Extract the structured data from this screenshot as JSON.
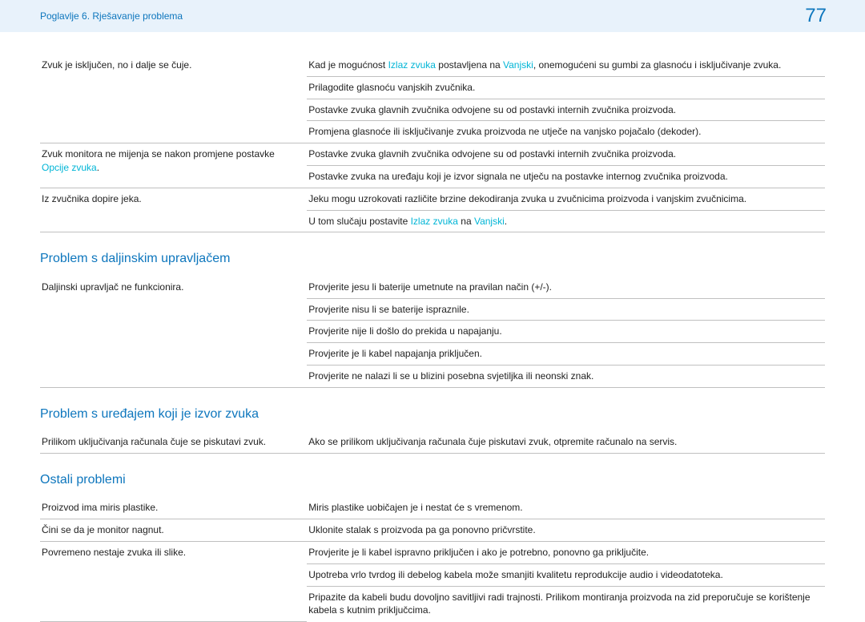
{
  "header": {
    "breadcrumb": "Poglavlje 6. Rješavanje problema",
    "page_number": "77"
  },
  "table1": {
    "rows": [
      {
        "left": "Zvuk je isključen, no i dalje se čuje.",
        "right_parts": [
          {
            "t": "Kad je mogućnost "
          },
          {
            "t": "Izlaz zvuka",
            "hl": true
          },
          {
            "t": " postavljena na "
          },
          {
            "t": "Vanjski",
            "hl": true
          },
          {
            "t": ", onemogućeni su gumbi za glasnoću i isključivanje zvuka."
          }
        ],
        "left_rowspan": 4
      },
      {
        "right_parts": [
          {
            "t": "Prilagodite glasnoću vanjskih zvučnika."
          }
        ]
      },
      {
        "right_parts": [
          {
            "t": "Postavke zvuka glavnih zvučnika odvojene su od postavki internih zvučnika proizvoda."
          }
        ]
      },
      {
        "right_parts": [
          {
            "t": "Promjena glasnoće ili isključivanje zvuka proizvoda ne utječe na vanjsko pojačalo (dekoder)."
          }
        ]
      },
      {
        "left_parts": [
          {
            "t": "Zvuk monitora ne mijenja se nakon promjene postavke "
          },
          {
            "t": "Opcije zvuka",
            "hl": true
          },
          {
            "t": "."
          }
        ],
        "right_parts": [
          {
            "t": "Postavke zvuka glavnih zvučnika odvojene su od postavki internih zvučnika proizvoda."
          }
        ],
        "left_rowspan": 2
      },
      {
        "right_parts": [
          {
            "t": "Postavke zvuka na uređaju koji je izvor signala ne utječu na postavke internog zvučnika proizvoda."
          }
        ]
      },
      {
        "left": "Iz zvučnika dopire jeka.",
        "right_parts": [
          {
            "t": "Jeku mogu uzrokovati različite brzine dekodiranja zvuka u zvučnicima proizvoda i vanjskim zvučnicima."
          }
        ],
        "left_rowspan": 2
      },
      {
        "right_parts": [
          {
            "t": "U tom slučaju postavite "
          },
          {
            "t": "Izlaz zvuka",
            "hl": true
          },
          {
            "t": " na "
          },
          {
            "t": "Vanjski",
            "hl": true
          },
          {
            "t": "."
          }
        ]
      }
    ]
  },
  "section2": {
    "title": "Problem s daljinskim upravljačem",
    "rows": [
      {
        "left": "Daljinski upravljač ne funkcionira.",
        "right": "Provjerite jesu li baterije umetnute na pravilan način (+/-).",
        "left_rowspan": 5
      },
      {
        "right": "Provjerite nisu li se baterije ispraznile."
      },
      {
        "right": "Provjerite nije li došlo do prekida u napajanju."
      },
      {
        "right": "Provjerite je li kabel napajanja priključen."
      },
      {
        "right": "Provjerite ne nalazi li se u blizini posebna svjetiljka ili neonski znak."
      }
    ]
  },
  "section3": {
    "title": "Problem s uređajem koji je izvor zvuka",
    "rows": [
      {
        "left": "Prilikom uključivanja računala čuje se piskutavi zvuk.",
        "right": "Ako se prilikom uključivanja računala čuje piskutavi zvuk, otpremite računalo na servis."
      }
    ]
  },
  "section4": {
    "title": "Ostali problemi",
    "rows": [
      {
        "left": "Proizvod ima miris plastike.",
        "right": "Miris plastike uobičajen je i nestat će s vremenom."
      },
      {
        "left": "Čini se da je monitor nagnut.",
        "right": "Uklonite stalak s proizvoda pa ga ponovno pričvrstite."
      },
      {
        "left": "Povremeno nestaje zvuka ili slike.",
        "right": "Provjerite je li kabel ispravno priključen i ako je potrebno, ponovno ga priključite.",
        "left_rowspan": 3
      },
      {
        "right": "Upotreba vrlo tvrdog ili debelog kabela može smanjiti kvalitetu reprodukcije audio i videodatoteka."
      },
      {
        "right": "Pripazite da kabeli budu dovoljno savitljivi radi trajnosti. Prilikom montiranja proizvoda na zid preporučuje se korištenje kabela s kutnim priključcima.",
        "no_border": true
      }
    ]
  }
}
